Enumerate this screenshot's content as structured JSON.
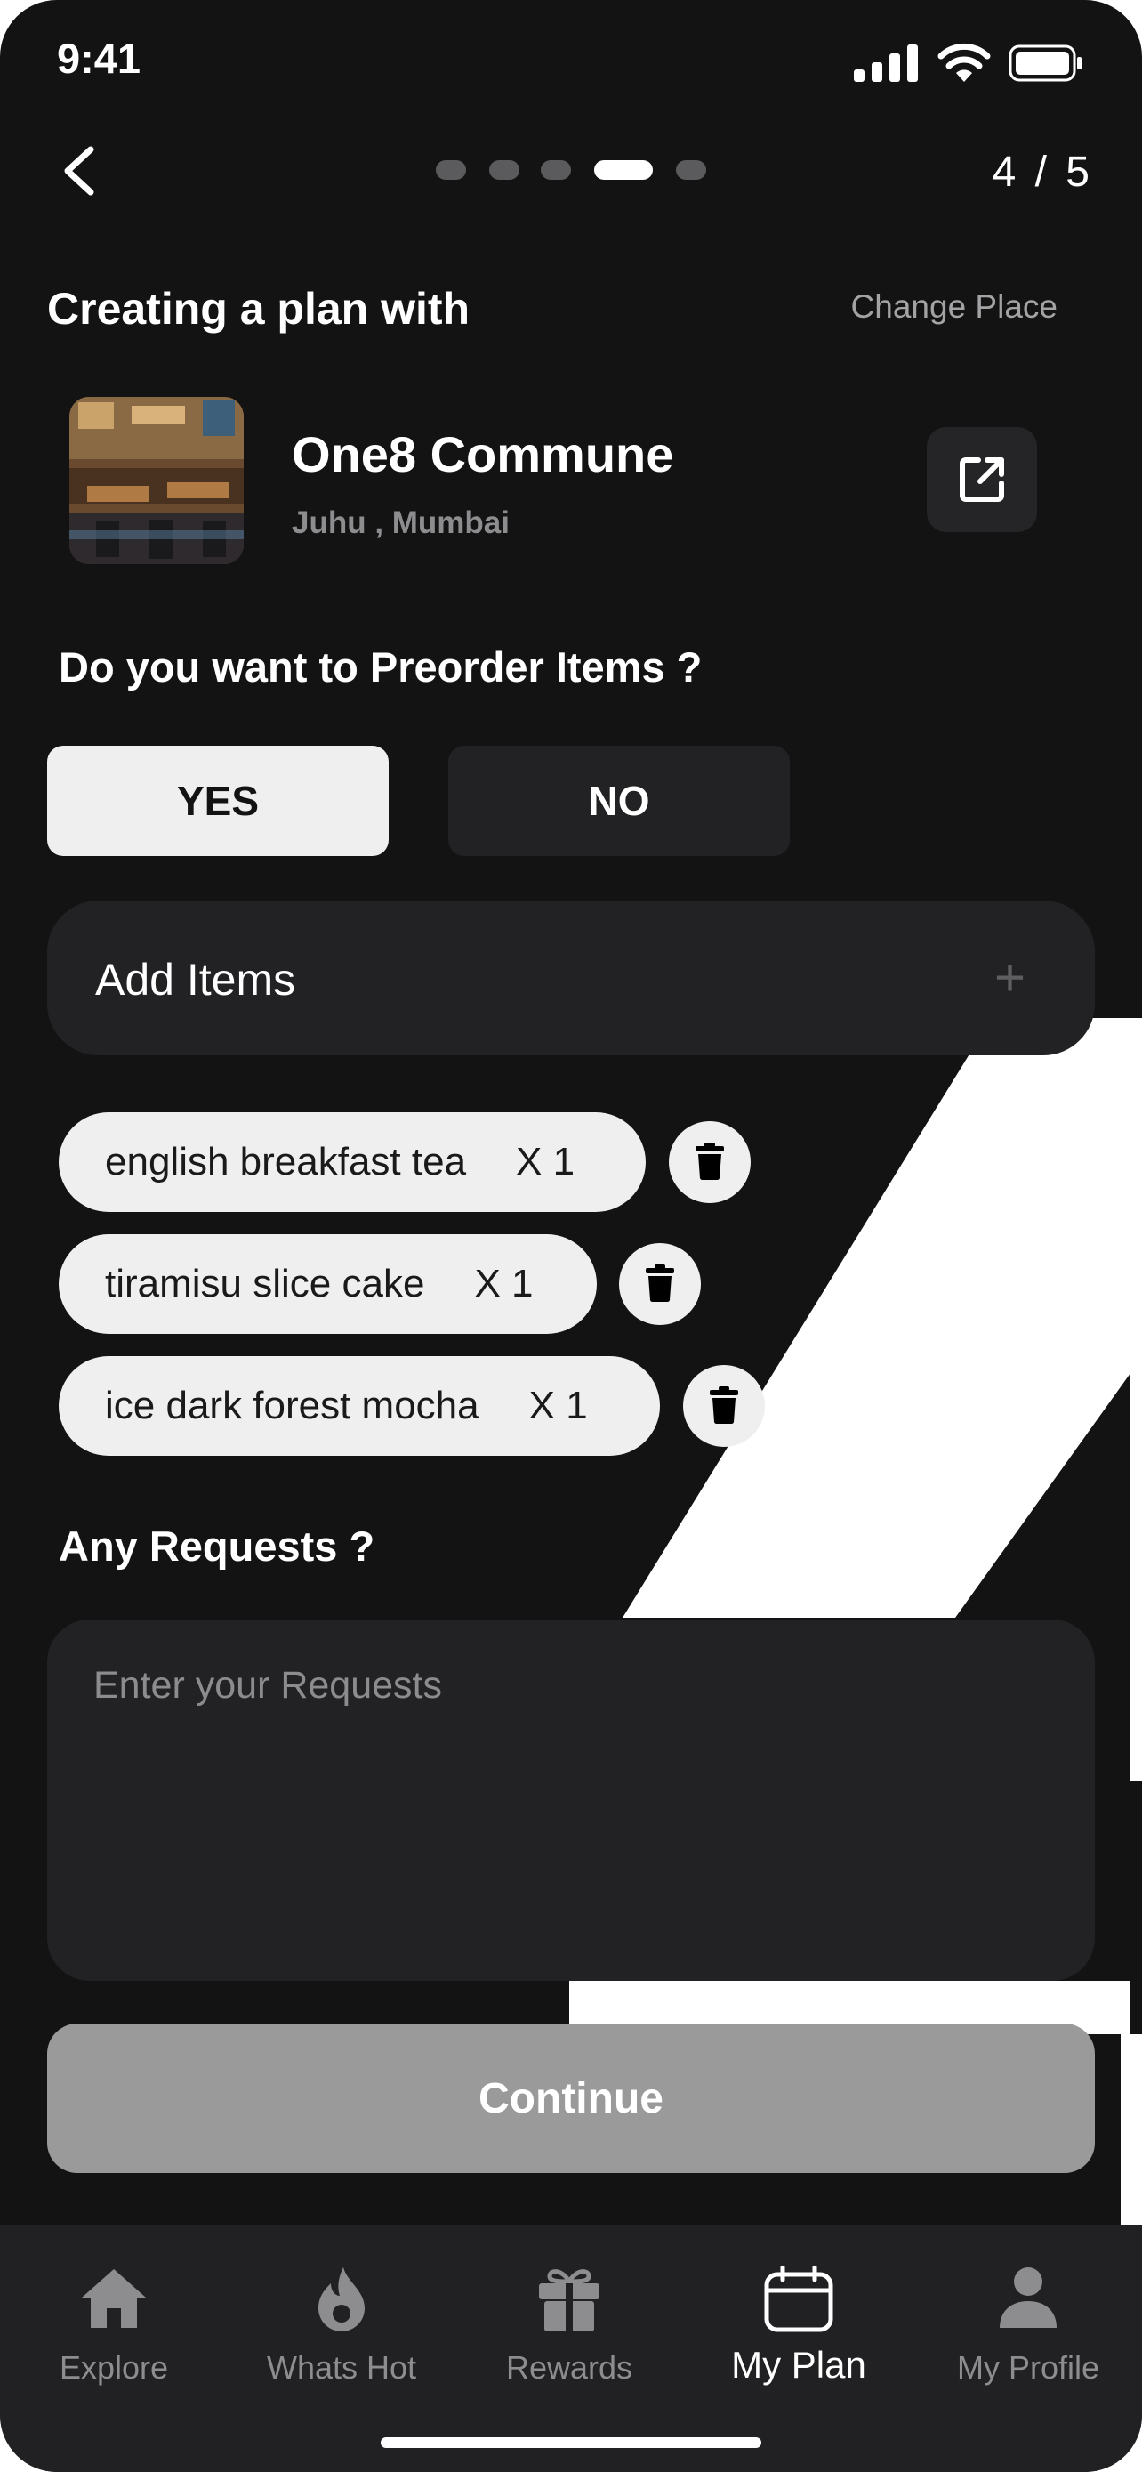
{
  "status_bar": {
    "time": "9:41"
  },
  "header": {
    "step_indicator": "4 / 5",
    "progress": {
      "current": 4,
      "total": 5
    }
  },
  "plan": {
    "title": "Creating a plan with",
    "change_place_label": "Change Place",
    "restaurant": {
      "name": "One8 Commune",
      "location": "Juhu , Mumbai"
    }
  },
  "preorder": {
    "question": "Do you want to Preorder Items ?",
    "yes_label": "YES",
    "no_label": "NO",
    "selected": "YES",
    "add_items_label": "Add Items",
    "items": [
      {
        "name": "english breakfast tea",
        "qty": "X 1"
      },
      {
        "name": "tiramisu slice cake",
        "qty": "X 1"
      },
      {
        "name": "ice dark forest mocha",
        "qty": "X 1"
      }
    ]
  },
  "requests": {
    "question": "Any Requests ?",
    "placeholder": "Enter your Requests",
    "value": ""
  },
  "continue_label": "Continue",
  "tabbar": {
    "active": "My Plan",
    "tabs": [
      {
        "label": "Explore",
        "icon": "home-icon"
      },
      {
        "label": "Whats Hot",
        "icon": "flame-icon"
      },
      {
        "label": "Rewards",
        "icon": "gift-icon"
      },
      {
        "label": "My Plan",
        "icon": "calendar-icon"
      },
      {
        "label": "My Profile",
        "icon": "person-icon"
      }
    ]
  },
  "colors": {
    "background": "#131314",
    "surface": "#222224",
    "chip": "#efefef",
    "muted_text": "#8d8d90",
    "continue_disabled": "#9a9a9a"
  }
}
